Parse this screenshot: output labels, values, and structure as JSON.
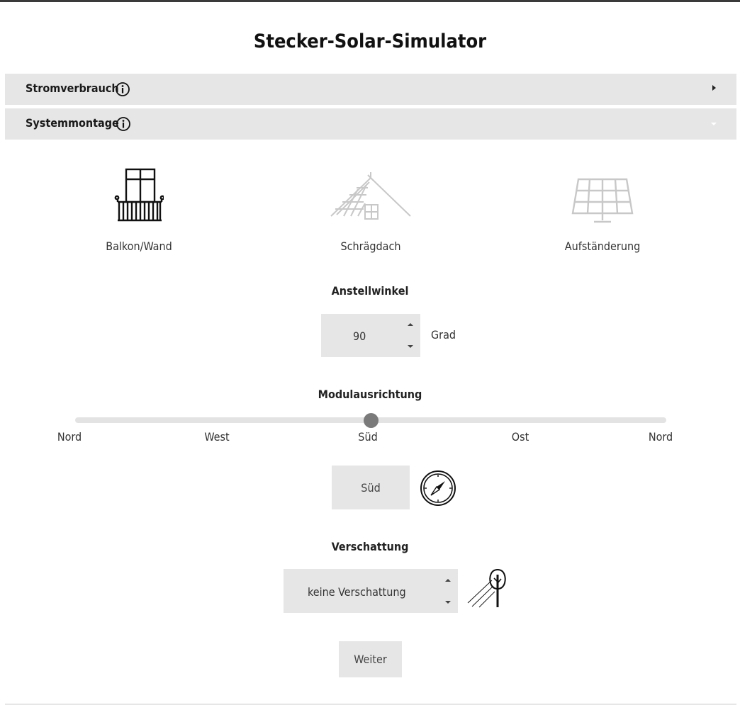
{
  "app": {
    "title": "Stecker-Solar-Simulator"
  },
  "accordion": [
    {
      "label": "Stromverbrauch",
      "state": "collapsed",
      "icon": "info-circle-icon"
    },
    {
      "label": "Systemmontage",
      "state": "expanded",
      "icon": "info-circle-icon"
    }
  ],
  "mounting": {
    "options": [
      {
        "label": "Balkon/Wand",
        "icon": "balcony-icon",
        "selected": true
      },
      {
        "label": "Schrägdach",
        "icon": "pitched-roof-icon",
        "selected": false
      },
      {
        "label": "Aufständerung",
        "icon": "solar-panel-stand-icon",
        "selected": false
      }
    ]
  },
  "angle": {
    "title": "Anstellwinkel",
    "value": "90",
    "unit": "Grad"
  },
  "orientation": {
    "title": "Modulausrichtung",
    "labels": [
      "Nord",
      "West",
      "Süd",
      "Ost",
      "Nord"
    ],
    "slider_value": 0.5,
    "selected": "Süd",
    "icon": "compass-icon"
  },
  "shading": {
    "title": "Verschattung",
    "value": "keine Verschattung",
    "icon": "tree-shade-icon"
  },
  "actions": {
    "next_label": "Weiter"
  },
  "colors": {
    "panel_bg": "#e6e6e6",
    "thumb": "#7a7a7a",
    "inactive_icon": "#c8c8c8",
    "active_icon": "#111111"
  }
}
